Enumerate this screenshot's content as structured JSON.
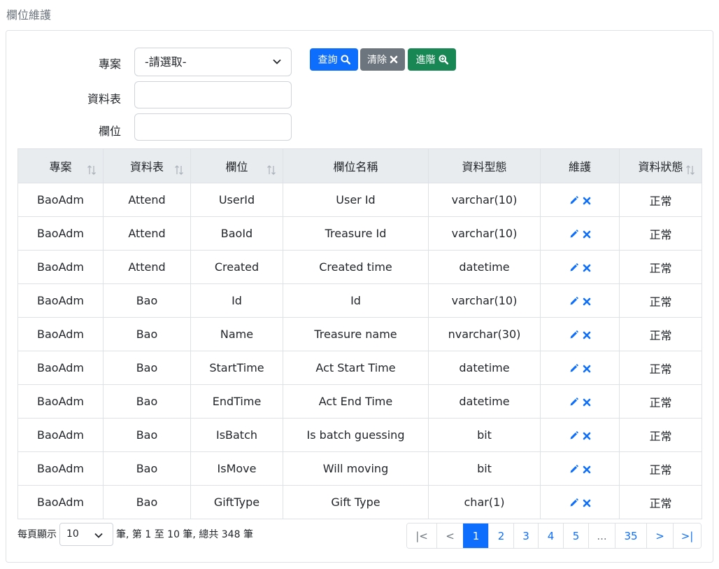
{
  "page": {
    "title": "欄位維護"
  },
  "filters": {
    "project_label": "專案",
    "project_selected": "-請選取-",
    "table_label": "資料表",
    "table_value": "",
    "field_label": "欄位",
    "field_value": ""
  },
  "buttons": {
    "query": "查詢",
    "clear": "清除",
    "advanced": "進階"
  },
  "table": {
    "headers": [
      "專案",
      "資料表",
      "欄位",
      "欄位名稱",
      "資料型態",
      "維護",
      "資料狀態"
    ],
    "rows": [
      [
        "BaoAdm",
        "Attend",
        "UserId",
        "User Id",
        "varchar(10)",
        "正常"
      ],
      [
        "BaoAdm",
        "Attend",
        "BaoId",
        "Treasure Id",
        "varchar(10)",
        "正常"
      ],
      [
        "BaoAdm",
        "Attend",
        "Created",
        "Created time",
        "datetime",
        "正常"
      ],
      [
        "BaoAdm",
        "Bao",
        "Id",
        "Id",
        "varchar(10)",
        "正常"
      ],
      [
        "BaoAdm",
        "Bao",
        "Name",
        "Treasure name",
        "nvarchar(30)",
        "正常"
      ],
      [
        "BaoAdm",
        "Bao",
        "StartTime",
        "Act Start Time",
        "datetime",
        "正常"
      ],
      [
        "BaoAdm",
        "Bao",
        "EndTime",
        "Act End Time",
        "datetime",
        "正常"
      ],
      [
        "BaoAdm",
        "Bao",
        "IsBatch",
        "Is batch guessing",
        "bit",
        "正常"
      ],
      [
        "BaoAdm",
        "Bao",
        "IsMove",
        "Will moving",
        "bit",
        "正常"
      ],
      [
        "BaoAdm",
        "Bao",
        "GiftType",
        "Gift Type",
        "char(1)",
        "正常"
      ]
    ]
  },
  "footer": {
    "per_page_label": "每頁顯示",
    "page_size": "10",
    "summary": "筆, 第 1 至 10 筆, 總共 348 筆"
  },
  "pagination": {
    "first": "|<",
    "prev": "<",
    "pages": [
      "1",
      "2",
      "3",
      "4",
      "5",
      "...",
      "35"
    ],
    "active": "1",
    "next": ">",
    "last": ">|"
  },
  "colors": {
    "primary": "#0d6efd",
    "secondary": "#6c757d",
    "success": "#198754",
    "danger": "#0d6efd"
  },
  "icons": [
    "search-icon",
    "close-icon",
    "zoom-in-icon",
    "pencil-icon",
    "sort-icon",
    "chevron-down-icon"
  ]
}
